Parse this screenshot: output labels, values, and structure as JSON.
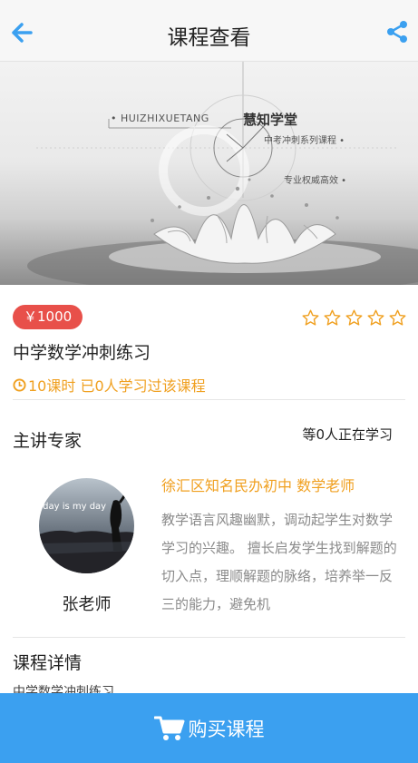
{
  "header": {
    "title": "课程查看",
    "back_icon": "arrow-left-icon",
    "share_icon": "share-icon"
  },
  "banner": {
    "brand_en": "• HUIZHIXUETANG",
    "brand_cn": "慧知学堂",
    "tag1": "中考冲刺系列课程 •",
    "tag2": "专业权威高效 •"
  },
  "course": {
    "price": "￥1000",
    "rating_stars": 5,
    "rating_filled": 0,
    "name": "中学数学冲刺练习",
    "meta": "10课时  已0人学习过该课程"
  },
  "expert": {
    "section_title": "主讲专家",
    "learning_count": "等0人正在学习",
    "teacher_name": "张老师",
    "teacher_title": "徐汇区知名民办初中 数学老师",
    "description": "教学语言风趣幽默，调动起学生对数学学习的兴趣。 擅长启发学生找到解题的切入点，理顺解题的脉络，培养举一反三的能力，避免机",
    "avatar_caption": "oday is my day"
  },
  "detail": {
    "section_title": "课程详情",
    "text": "中学数学冲刺练习"
  },
  "buy": {
    "label": "购买课程",
    "icon": "cart-icon"
  },
  "colors": {
    "accent": "#3ba0f0",
    "price": "#e8504a",
    "highlight": "#f0a020",
    "star": "#f0a020"
  }
}
